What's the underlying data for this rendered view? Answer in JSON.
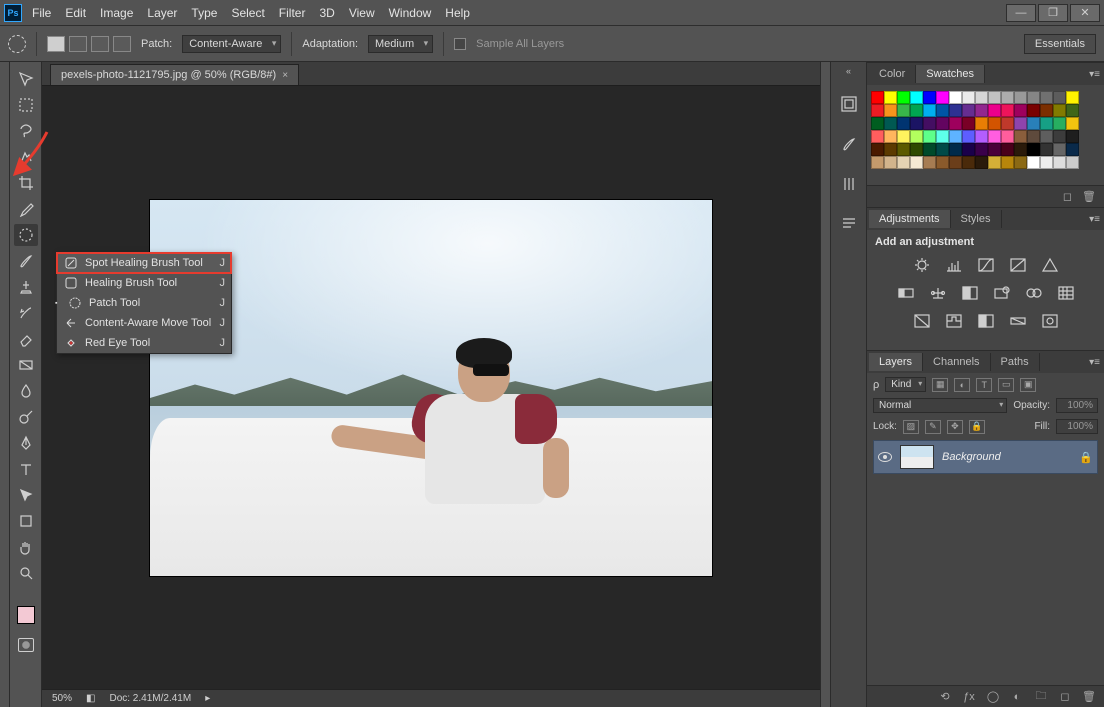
{
  "app": {
    "logo_text": "Ps"
  },
  "menus": [
    "File",
    "Edit",
    "Image",
    "Layer",
    "Type",
    "Select",
    "Filter",
    "3D",
    "View",
    "Window",
    "Help"
  ],
  "window_controls": {
    "minimize": "—",
    "maximize": "❐",
    "close": "✕"
  },
  "options_bar": {
    "patch_label": "Patch:",
    "patch_value": "Content-Aware",
    "adaptation_label": "Adaptation:",
    "adaptation_value": "Medium",
    "sample_all_label": "Sample All Layers",
    "workspace_btn": "Essentials"
  },
  "document": {
    "tab_title": "pexels-photo-1121795.jpg @ 50% (RGB/8#)",
    "zoom": "50%",
    "doc_size": "Doc: 2.41M/2.41M"
  },
  "flyout": {
    "items": [
      {
        "label": "Spot Healing Brush Tool",
        "shortcut": "J",
        "highlighted": true
      },
      {
        "label": "Healing Brush Tool",
        "shortcut": "J"
      },
      {
        "label": "Patch Tool",
        "shortcut": "J",
        "selected": true
      },
      {
        "label": "Content-Aware Move Tool",
        "shortcut": "J"
      },
      {
        "label": "Red Eye Tool",
        "shortcut": "J"
      }
    ]
  },
  "panels": {
    "color_tab": "Color",
    "swatches_tab": "Swatches",
    "adjustments_tab": "Adjustments",
    "styles_tab": "Styles",
    "add_adjustment": "Add an adjustment",
    "layers_tab": "Layers",
    "channels_tab": "Channels",
    "paths_tab": "Paths",
    "layers": {
      "kind_label": "Kind",
      "kind_icon": "ρ",
      "blend_mode": "Normal",
      "opacity_label": "Opacity:",
      "opacity_value": "100%",
      "lock_label": "Lock:",
      "fill_label": "Fill:",
      "fill_value": "100%",
      "entry_name": "Background"
    }
  },
  "swatch_colors": [
    "#ff0000",
    "#ffff00",
    "#00ff00",
    "#00ffff",
    "#0000ff",
    "#ff00ff",
    "#ffffff",
    "#ebebeb",
    "#d6d6d6",
    "#c2c2c2",
    "#adadad",
    "#999999",
    "#858585",
    "#707070",
    "#5c5c5c",
    "#fff200",
    "#ed1c24",
    "#f7941d",
    "#39b54a",
    "#00a651",
    "#00aeef",
    "#0054a6",
    "#2e3192",
    "#662d91",
    "#92278f",
    "#ec008c",
    "#ed145b",
    "#9e005d",
    "#790000",
    "#7b2e00",
    "#827b00",
    "#406618",
    "#005e20",
    "#005952",
    "#003471",
    "#1b1464",
    "#440e62",
    "#630460",
    "#9e005d",
    "#7a0026",
    "#e87e04",
    "#d35400",
    "#c0392b",
    "#8e44ad",
    "#2980b9",
    "#16a085",
    "#27ae60",
    "#f1c40f",
    "#ff5e5e",
    "#ffb65e",
    "#fff35e",
    "#b3ff5e",
    "#5eff8a",
    "#5effea",
    "#5eb3ff",
    "#5e5eff",
    "#b35eff",
    "#ff5ee0",
    "#ff5e9d",
    "#8a5e3c",
    "#5e4a3c",
    "#5e5e5e",
    "#3c3c3c",
    "#1e1e1e",
    "#4a1a00",
    "#5c3a00",
    "#5c5a00",
    "#2e4a00",
    "#004a2a",
    "#004a48",
    "#002a4a",
    "#1a004a",
    "#3a004a",
    "#4a003a",
    "#4a001a",
    "#2a1a0a",
    "#000000",
    "#333333",
    "#666666",
    "#0a2a4a",
    "#c49a6c",
    "#d2b48c",
    "#e5d3b3",
    "#f5e9d3",
    "#a67c52",
    "#8a5a2b",
    "#6b3e1a",
    "#4a2a0a",
    "#2a1a0a",
    "#d4af37",
    "#b8860b",
    "#8b6914",
    "#ffffff",
    "#eeeeee",
    "#dddddd",
    "#cccccc"
  ]
}
